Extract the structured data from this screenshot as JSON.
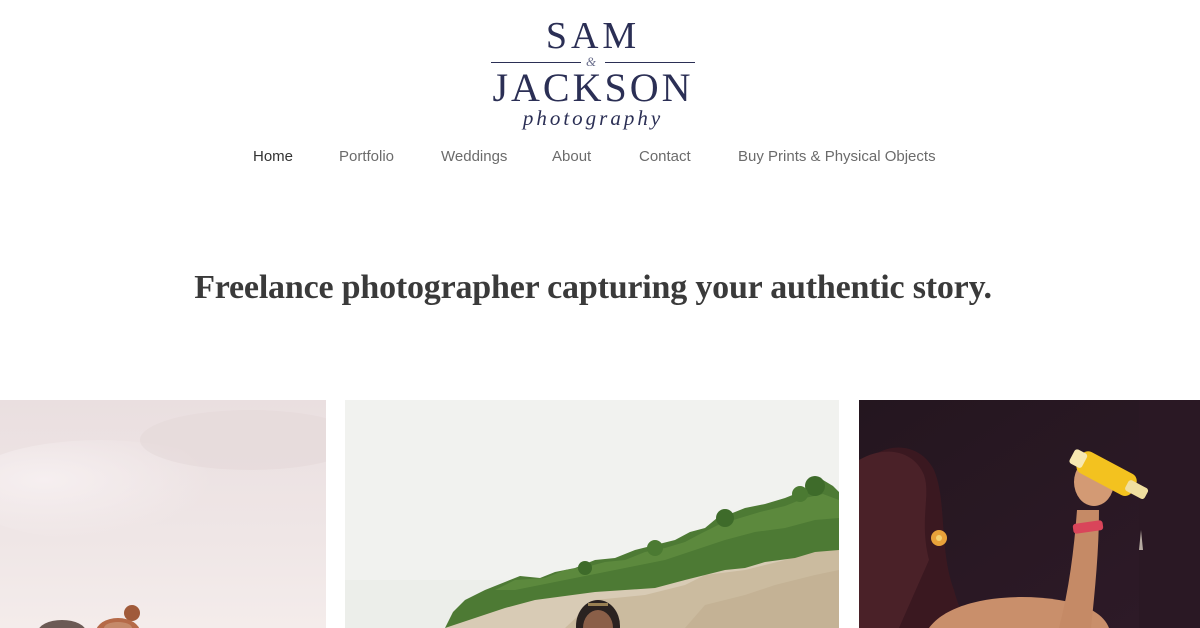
{
  "logo": {
    "line1": "SAM",
    "ampersand": "&",
    "line2": "JACKSON",
    "line3": "photography"
  },
  "nav": {
    "items": [
      {
        "label": "Home",
        "active": true
      },
      {
        "label": "Portfolio",
        "active": false
      },
      {
        "label": "Weddings",
        "active": false
      },
      {
        "label": "About",
        "active": false
      },
      {
        "label": "Contact",
        "active": false
      },
      {
        "label": "Buy Prints & Physical Objects",
        "active": false
      }
    ]
  },
  "hero": {
    "tagline": "Freelance photographer capturing your authentic story."
  },
  "gallery": {
    "photos": [
      {
        "subject": "people-by-the-sea-photo"
      },
      {
        "subject": "woman-at-scarborough-bluffs-photo"
      },
      {
        "subject": "performer-raising-bottle-photo"
      }
    ]
  },
  "colors": {
    "brand": "#2b2f55",
    "nav_text": "#6b6b6b",
    "nav_active": "#333333",
    "tagline": "#3a3a3a"
  }
}
